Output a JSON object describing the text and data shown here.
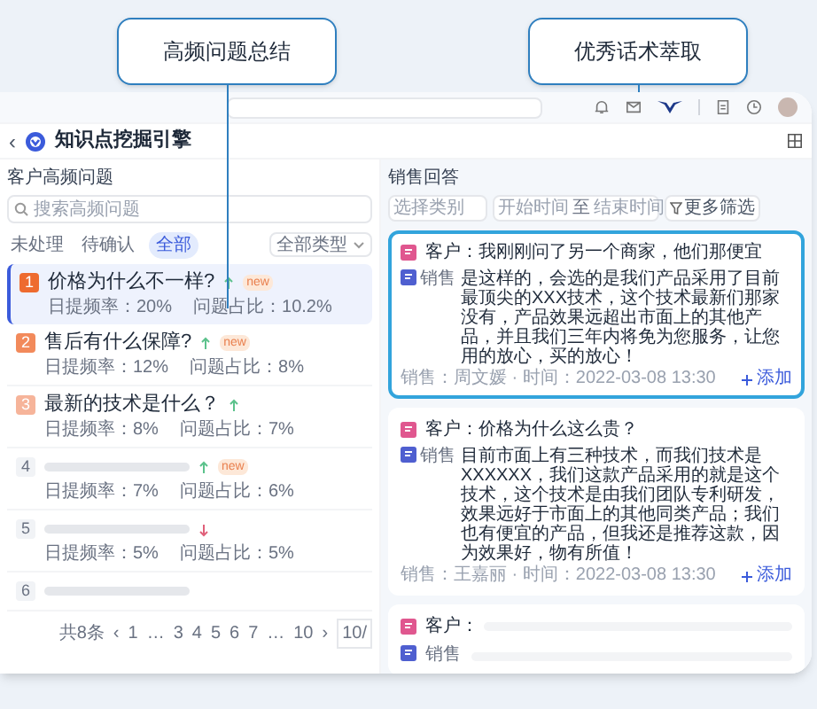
{
  "callouts": [
    {
      "label": "高频问题总结"
    },
    {
      "label": "优秀话术萃取"
    }
  ],
  "header": {
    "back": "‹",
    "title": "知识点挖掘引擎"
  },
  "questions": {
    "title": "客户高频问题",
    "search": {
      "placeholder": "搜索高频问题"
    },
    "filters": [
      {
        "label": "未处理",
        "selected": false
      },
      {
        "label": "待确认",
        "selected": false
      },
      {
        "label": "全部",
        "selected": true
      }
    ],
    "type_select": {
      "value": "全部类型"
    },
    "items": [
      {
        "kind": "question",
        "rank": "1",
        "color": "#ee6b2f",
        "title": "价格为什么不一样?",
        "rising": true,
        "badge": "new",
        "frequency": "日提频率：20%",
        "share": "问题占比：10.2%",
        "selected": true
      },
      {
        "kind": "question",
        "rank": "2",
        "color": "#f28a5b",
        "title": "售后有什么保障?",
        "rising": true,
        "badge": "new",
        "frequency": "日提频率：12%",
        "share": "问题占比：8%",
        "selected": false
      },
      {
        "kind": "question",
        "rank": "3",
        "color": "#f6b49a",
        "title": "最新的技术是什么？",
        "rising": true,
        "frequency": "日提频率：8%",
        "share": "问题占比：7%",
        "selected": false
      },
      {
        "kind": "placeholder",
        "rank": "4",
        "color": "#f1f3f6",
        "rising": true,
        "badge": "new",
        "frequency": "日提频率：7%",
        "share": "问题占比：6%",
        "selected": false
      },
      {
        "kind": "placeholder",
        "rank": "5",
        "color": "#f1f3f6",
        "rising": false,
        "frequency": "日提频率：5%",
        "share": "问题占比：5%",
        "selected": false
      },
      {
        "kind": "placeholder",
        "rank": "6",
        "color": "#f1f3f6",
        "selected": false
      }
    ],
    "pagination": {
      "total": "共8条",
      "pages": [
        "‹",
        "1",
        "…",
        "3",
        "4",
        "5",
        "6",
        "7",
        "…",
        "10",
        "›"
      ],
      "page_size": "10/"
    }
  },
  "answers": {
    "title": "销售回答",
    "category_select": {
      "placeholder": "选择类别"
    },
    "date_range": {
      "start_placeholder": "开始时间",
      "separator": "至",
      "end_placeholder": "结束时间"
    },
    "more_filters": "更多筛选",
    "cards": [
      {
        "kind": "answer",
        "selected": true,
        "question": "客户：我刚刚问了另一个商家，他们那便宜",
        "sales_label": "销售",
        "answer": "是这样的，会选的是我们产品采用了目前最顶尖的XXX技术，这个技术最新们那家没有，产品效果远超出市面上的其他产品，并且我们三年内将免为您服务，让您用的放心，买的放心！",
        "meta": "销售：周文媛 · 时间：2022-03-08 13:30",
        "add": "添加"
      },
      {
        "kind": "answer",
        "selected": false,
        "question": "客户：价格为什么这么贵？",
        "sales_label": "销售",
        "answer": "目前市面上有三种技术，而我们技术是XXXXXX，我们这款产品采用的就是这个技术，这个技术是由我们团队专利研发，效果远好于市面上的其他同类产品；我们也有便宜的产品，但我还是推荐这款，因为效果好，物有所值！",
        "meta": "销售：王嘉丽 · 时间：2022-03-08 13:30",
        "add": "添加"
      },
      {
        "kind": "placeholder",
        "selected": false,
        "question": "客户：",
        "sales_label": "销售"
      }
    ]
  }
}
